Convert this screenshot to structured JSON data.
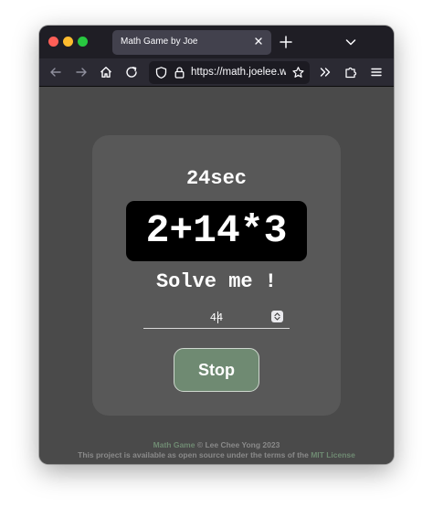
{
  "browser": {
    "tab_title": "Math Game by Joe",
    "url": "https://math.joelee.w"
  },
  "game": {
    "timer": "24sec",
    "equation": "2+14*3",
    "prompt": "Solve me !",
    "answer_value": "44",
    "stop_label": "Stop"
  },
  "footer": {
    "app_name": "Math Game",
    "copyright": " © Lee Chee Yong 2023",
    "license_prefix": "This project is available as open source under the terms of the ",
    "license_name": "MIT License"
  },
  "colors": {
    "page_bg": "#4a4a4a",
    "card_bg": "#585858",
    "accent": "#6f8a72",
    "equation_bg": "#000000"
  },
  "icons": {
    "back": "arrow-left-icon",
    "forward": "arrow-right-icon",
    "home": "home-icon",
    "reload": "reload-icon",
    "shield": "shield-icon",
    "lock": "lock-icon",
    "bookmark": "star-icon",
    "overflow": "chevrons-right-icon",
    "extensions": "puzzle-icon",
    "menu": "hamburger-menu-icon"
  }
}
